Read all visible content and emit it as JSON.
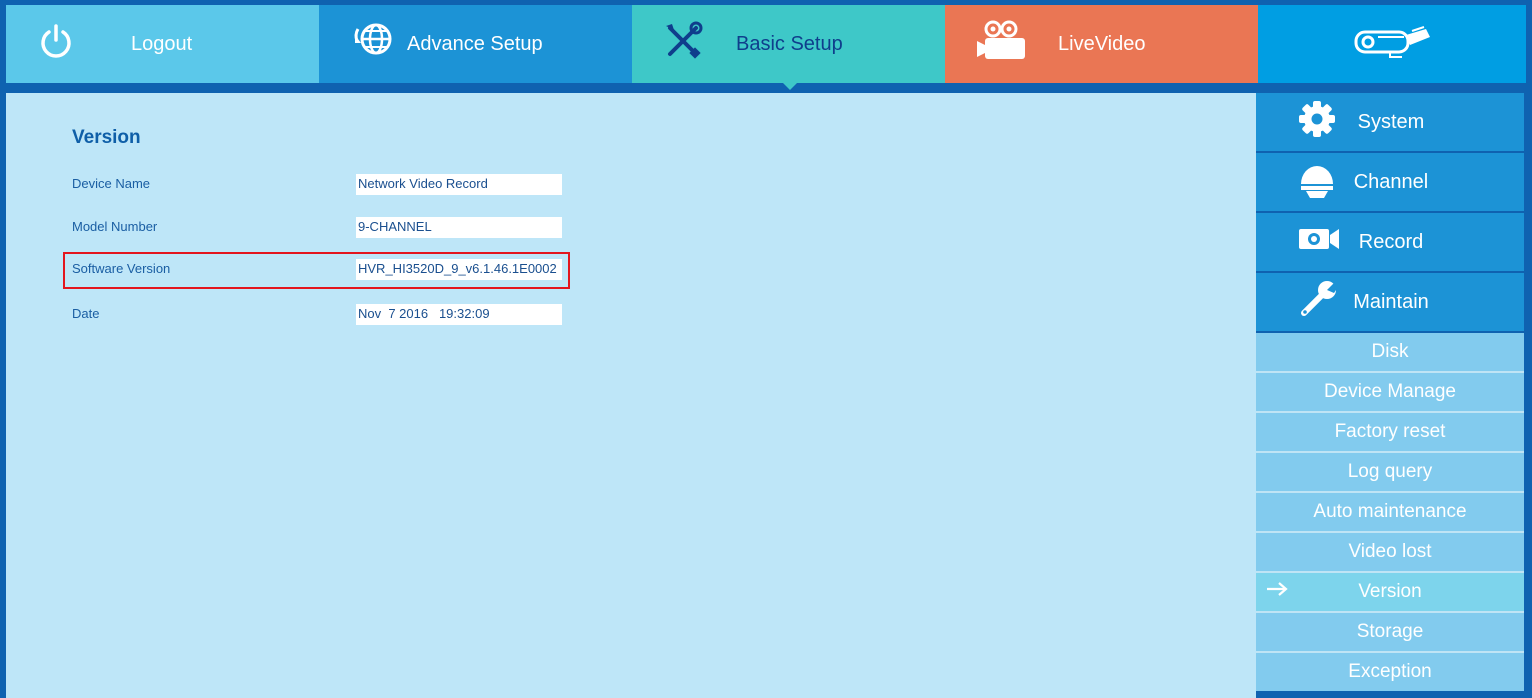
{
  "topnav": {
    "tabs": [
      {
        "label": "Logout",
        "icon": "power-icon"
      },
      {
        "label": "Advance Setup",
        "icon": "globe-icon"
      },
      {
        "label": "Basic Setup",
        "icon": "tools-icon"
      },
      {
        "label": "LiveVideo",
        "icon": "movie-camera-icon"
      }
    ],
    "logo_icon": "camera-logo-icon"
  },
  "main": {
    "title": "Version",
    "fields": [
      {
        "label": "Device Name",
        "value": "Network Video Record"
      },
      {
        "label": "Model Number",
        "value": "9-CHANNEL"
      },
      {
        "label": "Software Version",
        "value": "HVR_HI3520D_9_v6.1.46.1E0002"
      },
      {
        "label": "Date",
        "value": "Nov  7 2016   19:32:09"
      }
    ]
  },
  "sidebar": {
    "main_items": [
      {
        "label": "System",
        "icon": "gear-icon"
      },
      {
        "label": "Channel",
        "icon": "dome-camera-icon"
      },
      {
        "label": "Record",
        "icon": "video-camera-icon"
      },
      {
        "label": "Maintain",
        "icon": "wrench-icon"
      }
    ],
    "sub_items": [
      {
        "label": "Disk"
      },
      {
        "label": "Device Manage"
      },
      {
        "label": "Factory reset"
      },
      {
        "label": "Log query"
      },
      {
        "label": "Auto maintenance"
      },
      {
        "label": "Video lost"
      },
      {
        "label": "Version",
        "active": true
      },
      {
        "label": "Storage"
      },
      {
        "label": "Exception"
      }
    ]
  },
  "colors": {
    "frame": "#0f62b0",
    "content_bg": "#bee6f8",
    "highlight_border": "#e3161e",
    "tab_logout": "#5bc8ea",
    "tab_advance": "#1c93d6",
    "tab_basic": "#3ec8c8",
    "tab_live": "#ea7654",
    "tab_logo": "#009ee3"
  }
}
